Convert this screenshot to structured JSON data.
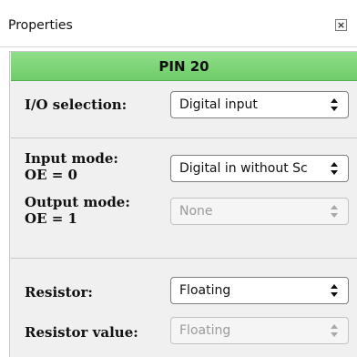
{
  "window": {
    "title": "Properties",
    "close_glyph": "⊠"
  },
  "pin": {
    "name": "PIN 20",
    "header_color": "#76d16f"
  },
  "fields": {
    "io_selection": {
      "label": "I/O selection:",
      "value": "Digital input"
    },
    "input_mode": {
      "label_line1": "Input mode:",
      "label_line2": "OE = 0",
      "value": "Digital in without Sc"
    },
    "output_mode": {
      "label_line1": "Output mode:",
      "label_line2": "OE = 1",
      "value": "None"
    },
    "resistor": {
      "label": "Resistor:",
      "value": "Floating"
    },
    "resistor_value": {
      "label": "Resistor value:",
      "value": "Floating"
    }
  },
  "icons": {
    "combo_arrow": "updown-arrows-icon",
    "close": "close-icon"
  }
}
